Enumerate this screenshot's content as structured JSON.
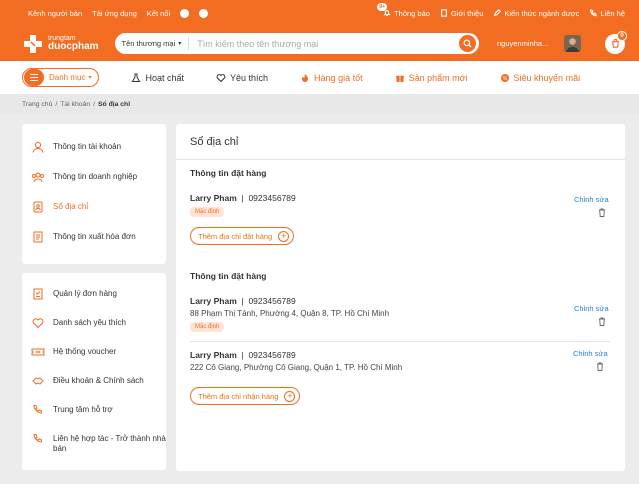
{
  "topbar": {
    "left_links": [
      "Kênh người bán",
      "Tải ứng dụng",
      "Kết nối"
    ],
    "notif_badge": "9+",
    "right_links": [
      "Thông báo",
      "Giới thiệu",
      "Kiến thức ngành dược",
      "Liên hệ"
    ]
  },
  "logo": {
    "line1": "trungtam",
    "line2": "duocpham"
  },
  "search": {
    "category": "Tên thương mại",
    "placeholder": "Tìm kiếm theo tên thương mại"
  },
  "user": {
    "name": "nguyenminha...",
    "cart_count": "0"
  },
  "nav": {
    "menu_label": "Danh mục",
    "items": [
      "Hoạt chất",
      "Yêu thích",
      "Hàng giá tốt",
      "Sản phẩm mới",
      "Siêu khuyến mãi"
    ]
  },
  "breadcrumb": [
    "Trang chủ",
    "Tài khoản",
    "Sổ địa chỉ"
  ],
  "sidebar": {
    "group1": [
      "Thông tin tài khoản",
      "Thông tin doanh nghiệp",
      "Sổ địa chỉ",
      "Thông tin xuất hóa đơn"
    ],
    "group2": [
      "Quản lý đơn hàng",
      "Danh sách yêu thích",
      "Hệ thống voucher",
      "Điều khoản & Chính sách",
      "Trung tâm hỗ trợ",
      "Liên hệ hợp tác - Trở thành nhà bán"
    ]
  },
  "content": {
    "title": "Sổ địa chỉ",
    "sections": [
      {
        "title": "Thông tin đặt hàng",
        "add_label": "Thêm địa chỉ đặt hàng",
        "addresses": [
          {
            "name": "Larry Pham",
            "phone": "0923456789",
            "address": "",
            "badge": "Mặc định",
            "edit": "Chỉnh sửa"
          }
        ]
      },
      {
        "title": "Thông tin đặt hàng",
        "add_label": "Thêm địa chỉ nhận hàng",
        "addresses": [
          {
            "name": "Larry Pham",
            "phone": "0923456789",
            "address": "88 Phạm Thị Tánh, Phường 4, Quận 8, TP. Hồ Chí Minh",
            "badge": "Mặc định",
            "edit": "Chỉnh sửa"
          },
          {
            "name": "Larry Pham",
            "phone": "0923456789",
            "address": "222 Cô Giang, Phường Cô Giang, Quận 1, TP. Hồ Chí Minh",
            "badge": "",
            "edit": "Chỉnh sửa"
          }
        ]
      }
    ]
  },
  "colors": {
    "brand": "#f26d21",
    "link": "#2a7fd4",
    "badge_bg": "#fde4d6"
  }
}
